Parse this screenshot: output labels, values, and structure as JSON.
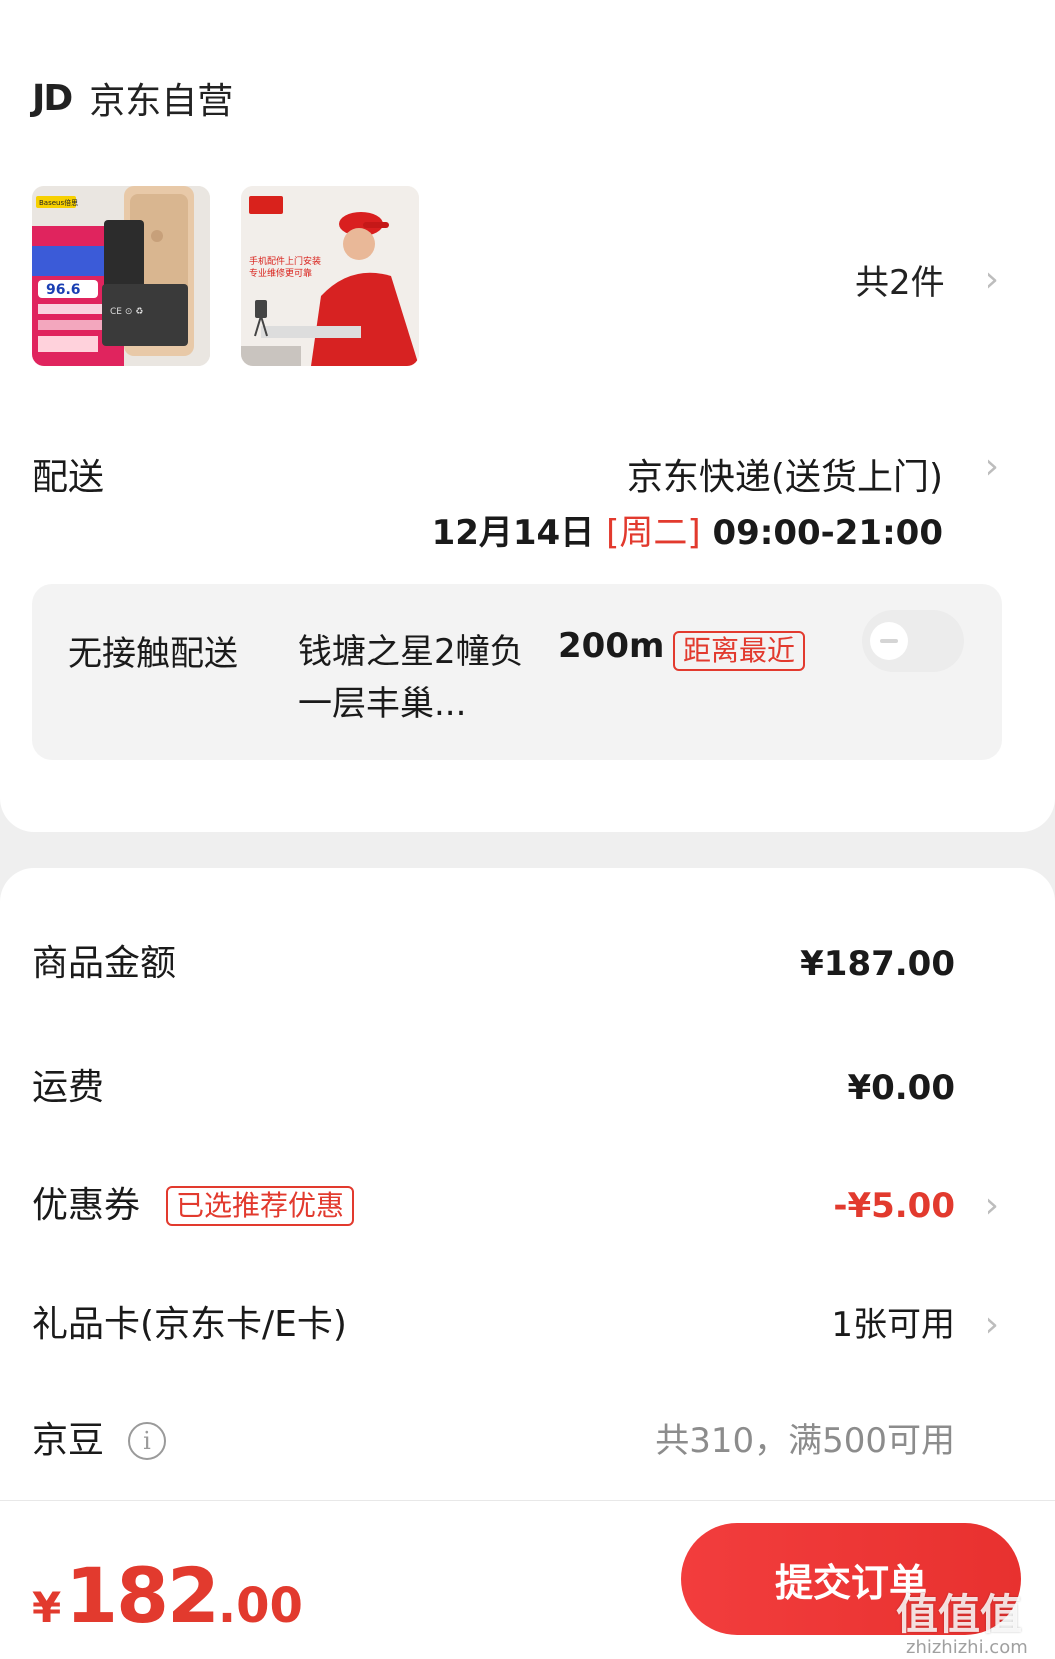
{
  "shop": {
    "logo": "JD",
    "name": "京东自营"
  },
  "items": {
    "count_label": "共2件",
    "thumb1_brand": "Baseus倍思",
    "thumb1_price": "96.6",
    "thumb2_line1": "手机配件上门安装",
    "thumb2_line2": "专业维修更可靠"
  },
  "shipping": {
    "label": "配送",
    "method": "京东快递(送货上门)",
    "date": "12月14日",
    "weekday": "[周二]",
    "time": "09:00-21:00"
  },
  "contactless": {
    "label": "无接触配送",
    "address": "钱塘之星2幢负一层丰巢...",
    "distance": "200m",
    "tag": "距离最近"
  },
  "summary": {
    "goods_label": "商品金额",
    "goods_value": "¥187.00",
    "freight_label": "运费",
    "freight_value": "¥0.00",
    "coupon_label": "优惠券",
    "coupon_tag": "已选推荐优惠",
    "coupon_value": "-¥5.00",
    "giftcard_label": "礼品卡(京东卡/E卡)",
    "giftcard_value": "1张可用",
    "beans_label": "京豆",
    "beans_value": "共310，满500可用"
  },
  "footer": {
    "currency": "¥",
    "total_int": "182",
    "total_dec": ".00",
    "submit_label": "提交订单",
    "watermark": "值值值",
    "watermark_sub": "zhizhizhi.com"
  },
  "colors": {
    "accent": "#e23a2e",
    "button": "#f23d3d"
  },
  "icons": {
    "chevron": "chevron-right-icon",
    "info": "info-icon"
  }
}
